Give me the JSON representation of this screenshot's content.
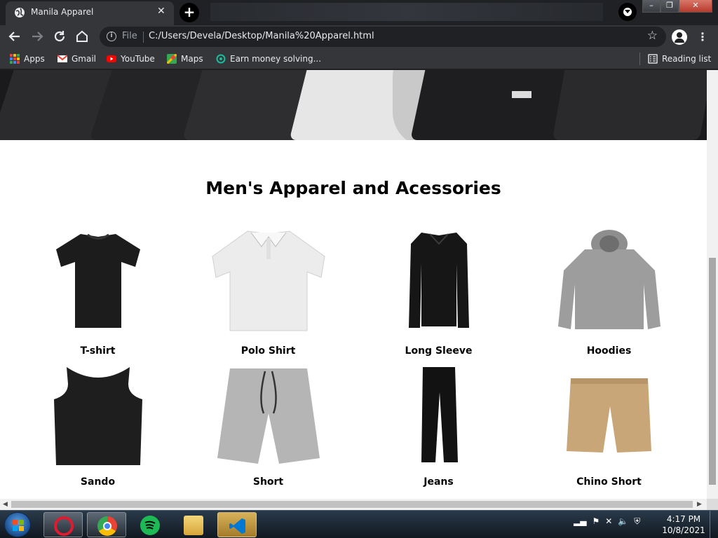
{
  "browser": {
    "tab_title": "Manila Apparel",
    "tab_close": "✕",
    "new_tab": "+",
    "address": {
      "scheme_label": "File",
      "url": "C:/Users/Devela/Desktop/Manila%20Apparel.html"
    },
    "bookmarks": [
      {
        "label": "Apps",
        "icon": "apps-grid-icon"
      },
      {
        "label": "Gmail",
        "icon": "gmail-icon"
      },
      {
        "label": "YouTube",
        "icon": "youtube-icon"
      },
      {
        "label": "Maps",
        "icon": "maps-icon"
      },
      {
        "label": "Earn money solving...",
        "icon": "bookmark-site-icon"
      }
    ],
    "reading_list": "Reading list"
  },
  "page": {
    "heading": "Men's Apparel and Acessories",
    "products": [
      {
        "name": "T-shirt",
        "color": "#1c1c1c"
      },
      {
        "name": "Polo Shirt",
        "color": "#eeeeee"
      },
      {
        "name": "Long Sleeve",
        "color": "#161616"
      },
      {
        "name": "Hoodies",
        "color": "#9d9d9d"
      },
      {
        "name": "Sando",
        "color": "#1e1e1e"
      },
      {
        "name": "Short",
        "color": "#b5b5b5"
      },
      {
        "name": "Jeans",
        "color": "#121212"
      },
      {
        "name": "Chino Short",
        "color": "#c9a678"
      }
    ]
  },
  "taskbar": {
    "time": "4:17 PM",
    "date": "10/8/2021"
  }
}
